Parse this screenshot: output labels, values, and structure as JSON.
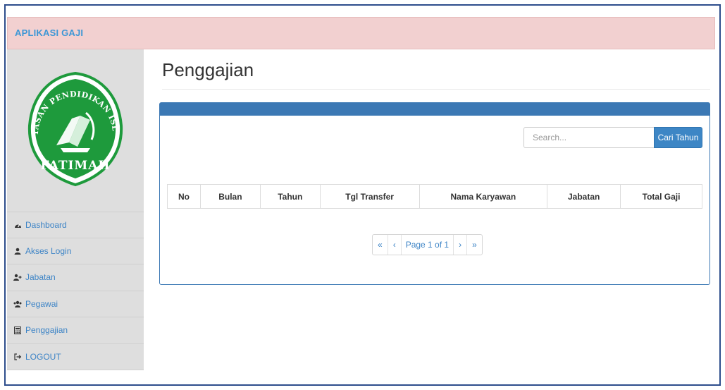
{
  "app": {
    "title": "APLIKASI GAJI"
  },
  "logo": {
    "arc_text": "YAYASAN PENDIDIKAN ISLAM",
    "name": "FATIMAH"
  },
  "sidebar": {
    "items": [
      {
        "label": "Dashboard",
        "icon": "dashboard-icon"
      },
      {
        "label": "Akses Login",
        "icon": "user-icon"
      },
      {
        "label": "Jabatan",
        "icon": "user-plus-icon"
      },
      {
        "label": "Pegawai",
        "icon": "users-icon"
      },
      {
        "label": "Penggajian",
        "icon": "calculator-icon"
      },
      {
        "label": "LOGOUT",
        "icon": "logout-icon"
      }
    ]
  },
  "page": {
    "title": "Penggajian"
  },
  "search": {
    "placeholder": "Search...",
    "button_label": "Cari Tahun"
  },
  "table": {
    "headers": [
      "No",
      "Bulan",
      "Tahun",
      "Tgl Transfer",
      "Nama Karyawan",
      "Jabatan",
      "Total Gaji"
    ]
  },
  "pagination": {
    "first": "«",
    "prev": "‹",
    "info": "Page 1 of 1",
    "next": "›",
    "last": "»"
  },
  "colors": {
    "topbar": "#f2d0d0",
    "brand_text": "#3d97d6",
    "sidebar_bg": "#dedede",
    "panel_accent": "#3b78b4",
    "button": "#3d86c5",
    "logo_green": "#1e9a3c"
  }
}
